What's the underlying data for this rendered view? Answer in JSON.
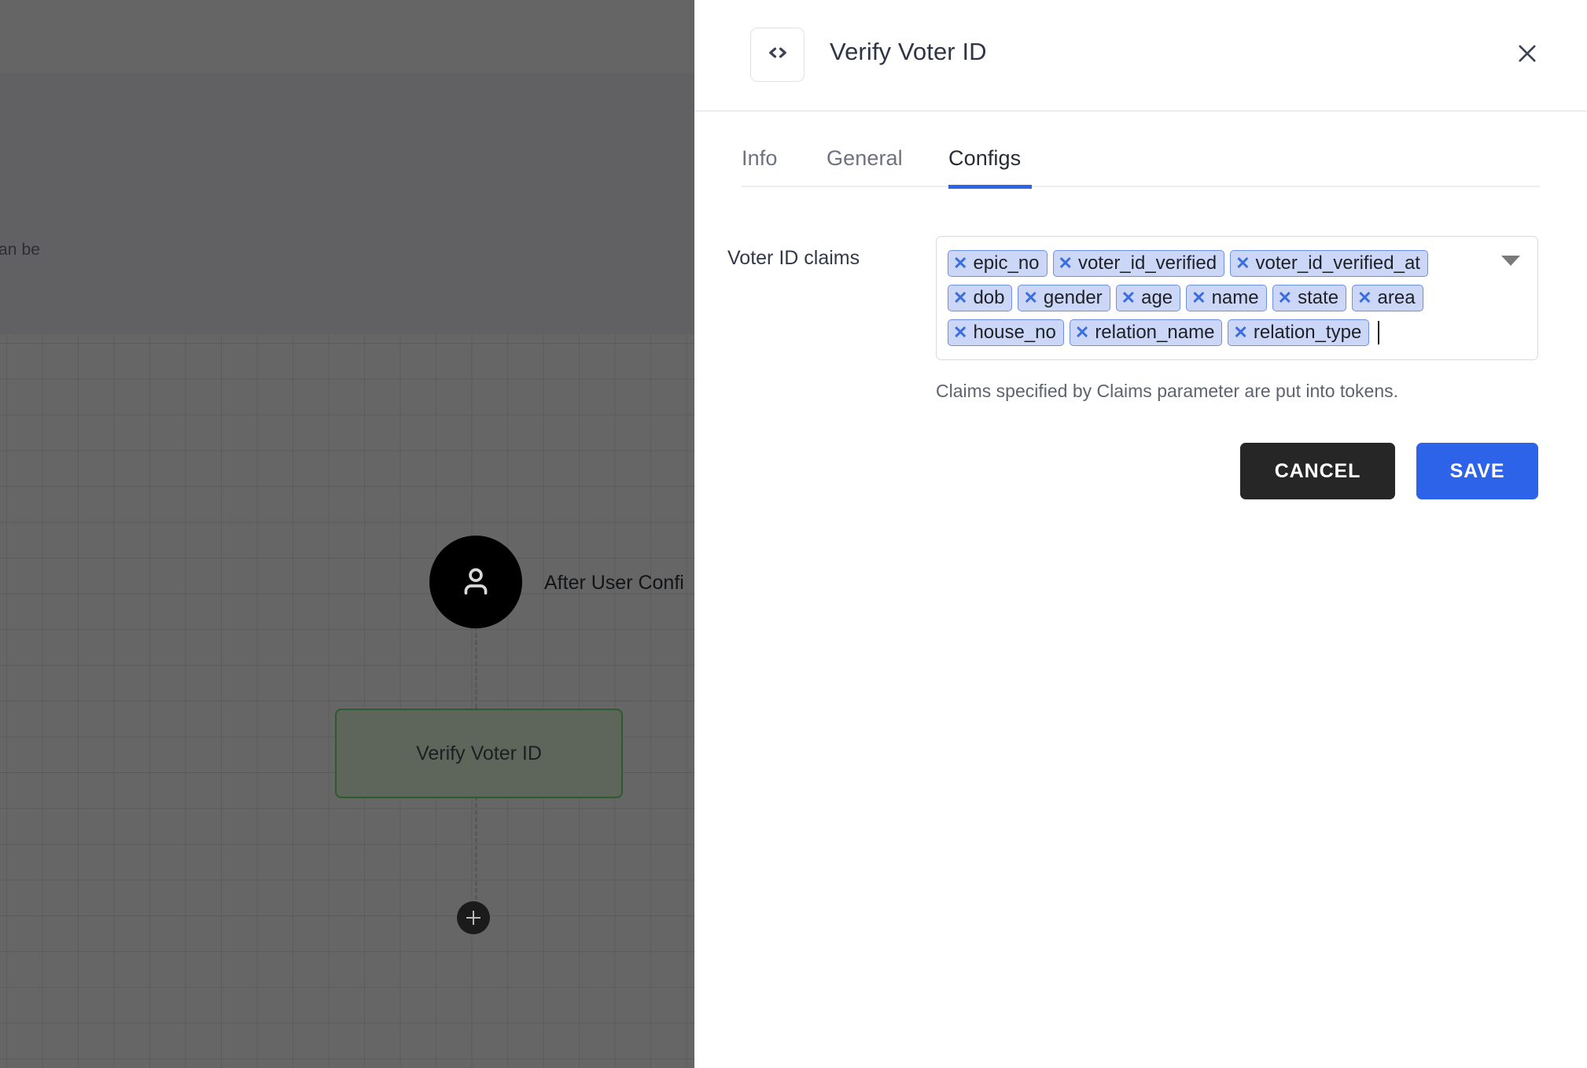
{
  "canvas": {
    "description_fragment": "er. It can be",
    "start_node": {
      "icon": "user-icon",
      "label": "After User Confi"
    },
    "task_node": {
      "label": "Verify Voter ID"
    },
    "add_button": {
      "icon": "plus-icon"
    }
  },
  "drawer": {
    "header": {
      "icon": "code-brackets-icon",
      "title": "Verify Voter ID",
      "close_icon": "close-icon"
    },
    "tabs": [
      {
        "label": "Info",
        "active": false
      },
      {
        "label": "General",
        "active": false
      },
      {
        "label": "Configs",
        "active": true
      }
    ],
    "form": {
      "field_label": "Voter ID claims",
      "chips": [
        "epic_no",
        "voter_id_verified",
        "voter_id_verified_at",
        "dob",
        "gender",
        "age",
        "name",
        "state",
        "area",
        "house_no",
        "relation_name",
        "relation_type"
      ],
      "chip_remove_glyph": "✕",
      "dropdown_icon": "chevron-down-icon",
      "helper_text": "Claims specified by Claims parameter are put into tokens."
    },
    "actions": {
      "cancel_label": "CANCEL",
      "save_label": "SAVE"
    },
    "colors": {
      "accent": "#2d63e8",
      "cancel_bg": "#262626",
      "chip_bg": "#ccd7f8",
      "chip_border": "#6d8fe8"
    }
  }
}
